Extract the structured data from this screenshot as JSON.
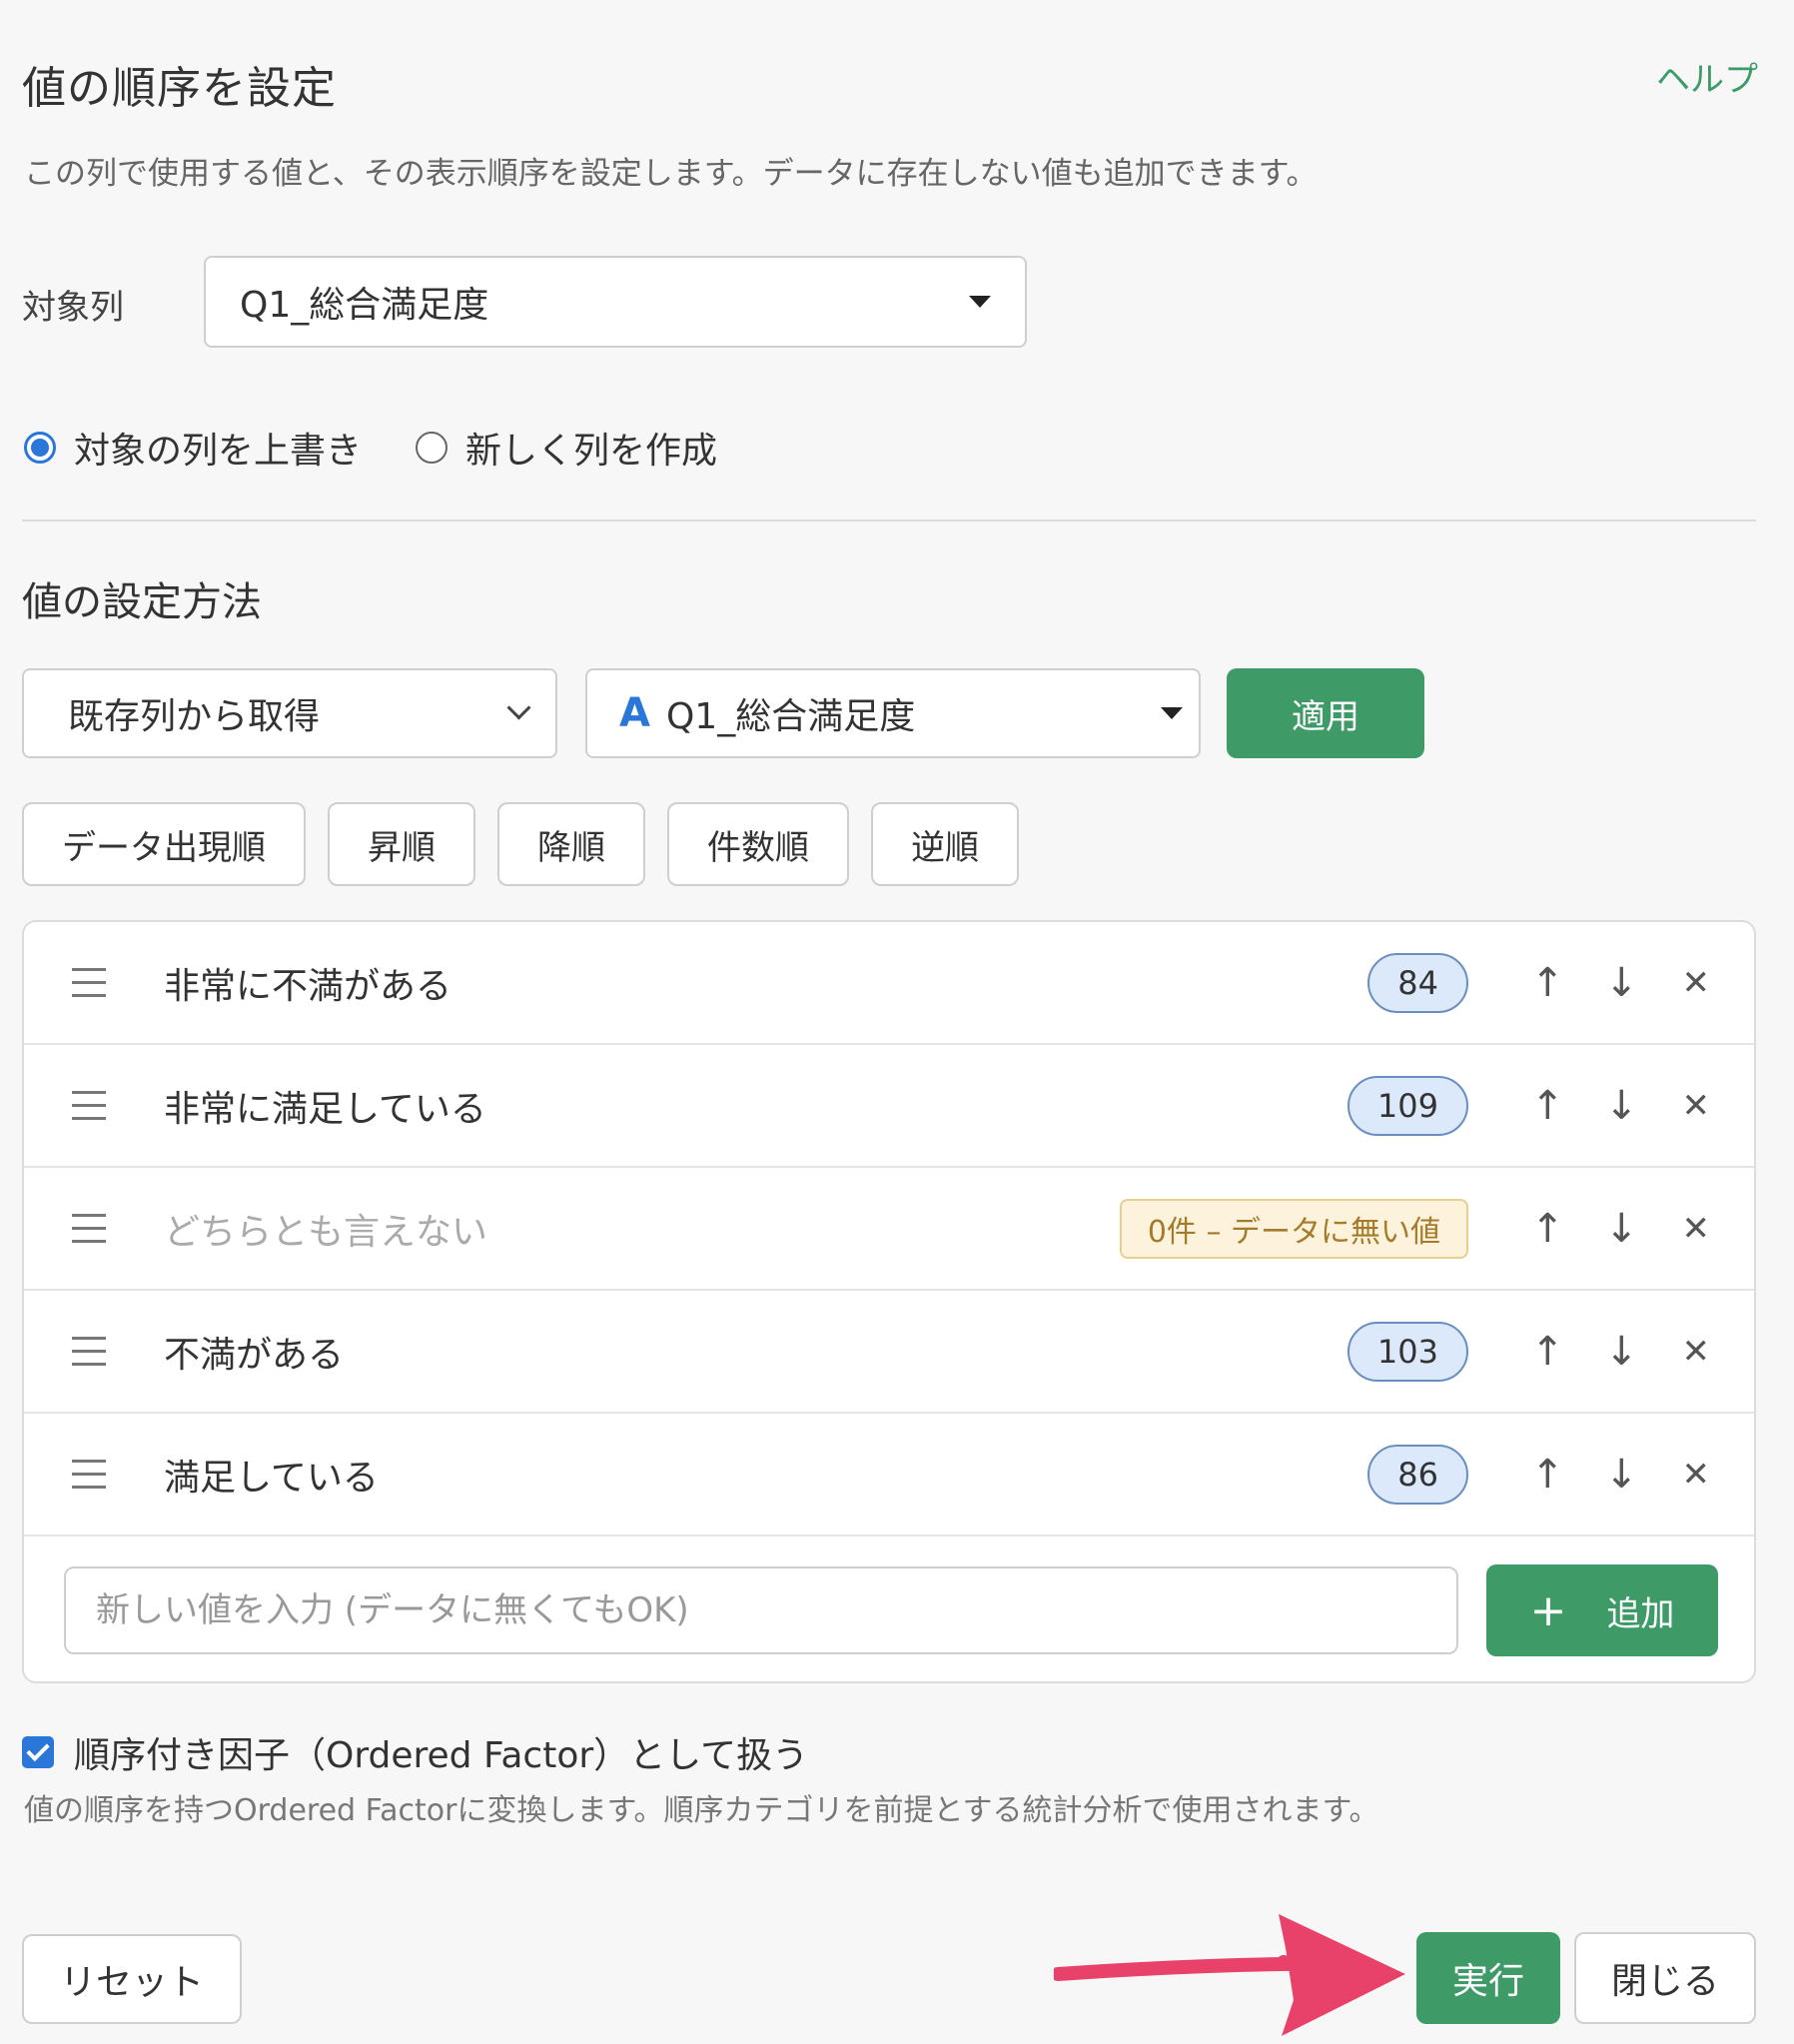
{
  "header": {
    "title": "値の順序を設定",
    "help": "ヘルプ",
    "description": "この列で使用する値と、その表示順序を設定します。データに存在しない値も追加できます。"
  },
  "target": {
    "label": "対象列",
    "selected": "Q1_総合満足度"
  },
  "mode": {
    "overwrite": "対象の列を上書き",
    "create_new": "新しく列を作成"
  },
  "method": {
    "title": "値の設定方法",
    "source_select": "既存列から取得",
    "column_icon": "A",
    "column_select": "Q1_総合満足度",
    "apply": "適用"
  },
  "sort_buttons": [
    "データ出現順",
    "昇順",
    "降順",
    "件数順",
    "逆順"
  ],
  "values": [
    {
      "label": "非常に不満がある",
      "count": "84"
    },
    {
      "label": "非常に満足している",
      "count": "109"
    },
    {
      "label": "どちらとも言えない",
      "count": "0件 – データに無い値"
    },
    {
      "label": "不満がある",
      "count": "103"
    },
    {
      "label": "満足している",
      "count": "86"
    }
  ],
  "row_controls": {
    "up": "↑",
    "down": "↓",
    "remove": "✕"
  },
  "new_value": {
    "placeholder": "新しい値を入力 (データに無くてもOK)",
    "add_icon": "+",
    "add_label": "追加"
  },
  "ordered_factor": {
    "label": "順序付き因子（Ordered Factor）として扱う",
    "description": "値の順序を持つOrdered Factorに変換します。順序カテゴリを前提とする統計分析で使用されます。"
  },
  "footer": {
    "reset": "リセット",
    "run": "実行",
    "close": "閉じる"
  },
  "colors": {
    "accent_green": "#3e9b68",
    "accent_blue": "#2b76d9",
    "arrow_pink": "#e8416a"
  }
}
